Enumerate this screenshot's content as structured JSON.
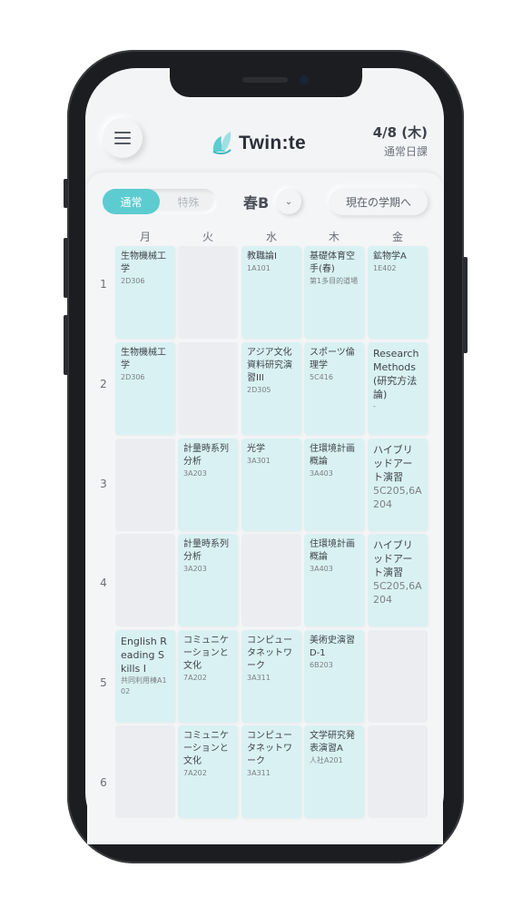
{
  "header": {
    "app_title": "Twin:te",
    "date": "4/8 (木)",
    "day_type": "通常日課"
  },
  "controls": {
    "mode_normal": "通常",
    "mode_special": "特殊",
    "term": "春B",
    "current_term_button": "現在の学期へ"
  },
  "colors": {
    "accent": "#5dccd0",
    "cell_filled": "#d9f1f2",
    "cell_empty": "#ebedf0"
  },
  "timetable": {
    "days": [
      "月",
      "火",
      "水",
      "木",
      "金"
    ],
    "periods": [
      "1",
      "2",
      "3",
      "4",
      "5",
      "6"
    ],
    "rows": [
      [
        {
          "name": "生物機械工学",
          "room": "2D306"
        },
        null,
        {
          "name": "教職論I",
          "room": "1A101"
        },
        {
          "name": "基礎体育空手(春)",
          "room": "第1多目的道場"
        },
        {
          "name": "鉱物学A",
          "room": "1E402"
        }
      ],
      [
        {
          "name": "生物機械工学",
          "room": "2D306"
        },
        null,
        {
          "name": "アジア文化資料研究演習III",
          "room": "2D305"
        },
        {
          "name": "スポーツ倫理学",
          "room": "5C416"
        },
        {
          "name": "Research Methods (研究方法論)",
          "room": "-"
        }
      ],
      [
        null,
        {
          "name": "計量時系列分析",
          "room": "3A203"
        },
        {
          "name": "光学",
          "room": "3A301"
        },
        {
          "name": "住環境計画概論",
          "room": "3A403"
        },
        {
          "name": "ハイブリッドアート演習",
          "room": "5C205,6A204"
        }
      ],
      [
        null,
        {
          "name": "計量時系列分析",
          "room": "3A203"
        },
        null,
        {
          "name": "住環境計画概論",
          "room": "3A403"
        },
        {
          "name": "ハイブリッドアート演習",
          "room": "5C205,6A204"
        }
      ],
      [
        {
          "name": "English Reading Skills I",
          "room": "共同利用棟A102"
        },
        {
          "name": "コミュニケーションと文化",
          "room": "7A202"
        },
        {
          "name": "コンピュータネットワーク",
          "room": "3A311"
        },
        {
          "name": "美術史演習D-1",
          "room": "6B203"
        },
        null
      ],
      [
        null,
        {
          "name": "コミュニケーションと文化",
          "room": "7A202"
        },
        {
          "name": "コンピュータネットワーク",
          "room": "3A311"
        },
        {
          "name": "文学研究発表演習A",
          "room": "人社A201"
        },
        null
      ]
    ]
  }
}
